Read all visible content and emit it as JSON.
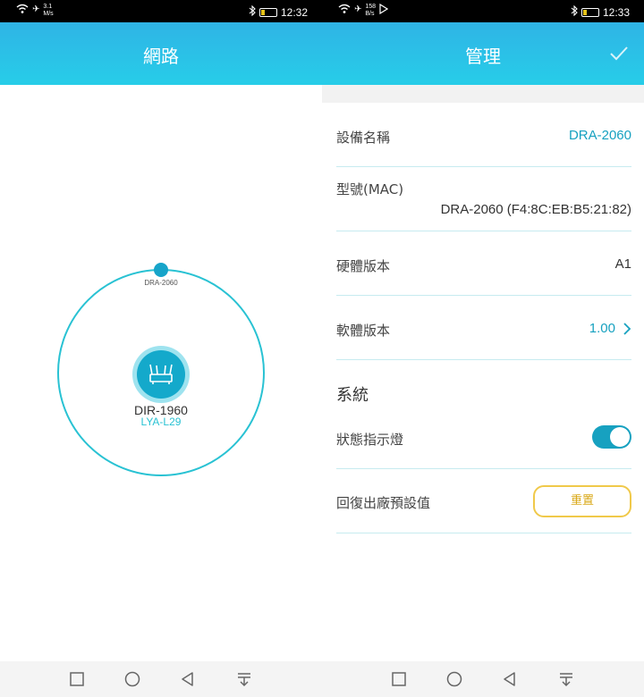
{
  "left_screen": {
    "status_bar": {
      "speed_value": "3.1",
      "speed_unit": "M/s",
      "time": "12:32",
      "battery": "19"
    },
    "header": {
      "title": "網路"
    },
    "network": {
      "satellite_name": "DRA-2060",
      "router_name": "DIR-1960",
      "client_name": "LYA-L29"
    },
    "nav": [
      "square-icon",
      "circle-icon",
      "back-triangle-icon",
      "notification-down-icon"
    ]
  },
  "right_screen": {
    "status_bar": {
      "speed_value": "158",
      "speed_unit": "B/s",
      "time": "12:33",
      "battery": "19"
    },
    "header": {
      "title": "管理"
    },
    "device": {
      "name_label": "設備名稱",
      "name_value": "DRA-2060",
      "model_label": "型號(MAC)",
      "model_value": "DRA-2060 (F4:8C:EB:B5:21:82)",
      "hardware_label": "硬體版本",
      "hardware_value": "A1",
      "firmware_label": "軟體版本",
      "firmware_value": "1.00"
    },
    "system": {
      "section_title": "系統",
      "led_label": "狀態指示燈",
      "led_on": true,
      "reset_label": "回復出廠預設值",
      "reset_button": "重置"
    },
    "nav": [
      "square-icon",
      "circle-icon",
      "back-triangle-icon",
      "notification-down-icon"
    ]
  },
  "colors": {
    "accent": "#17a1c0",
    "header_top": "#2fb4e6",
    "header_bottom": "#27cde8",
    "orbit": "#29c2d3",
    "reset_border": "#f0c94a"
  }
}
